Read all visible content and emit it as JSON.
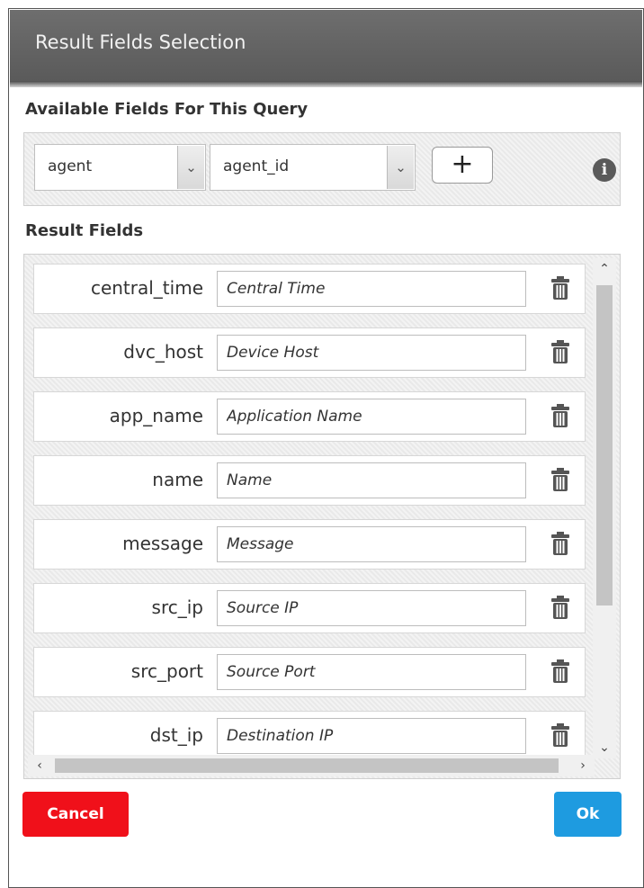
{
  "dialog": {
    "title": "Result Fields Selection"
  },
  "available": {
    "label": "Available Fields For This Query",
    "select1_value": "agent",
    "select2_value": "agent_id",
    "add_label": "+",
    "info_label": "i"
  },
  "results": {
    "label": "Result Fields",
    "rows": [
      {
        "field": "central_time",
        "alias": "Central Time"
      },
      {
        "field": "dvc_host",
        "alias": "Device Host"
      },
      {
        "field": "app_name",
        "alias": "Application Name"
      },
      {
        "field": "name",
        "alias": "Name"
      },
      {
        "field": "message",
        "alias": "Message"
      },
      {
        "field": "src_ip",
        "alias": "Source IP"
      },
      {
        "field": "src_port",
        "alias": "Source Port"
      },
      {
        "field": "dst_ip",
        "alias": "Destination IP"
      }
    ]
  },
  "footer": {
    "cancel_label": "Cancel",
    "ok_label": "Ok"
  },
  "colors": {
    "cancel": "#f0101a",
    "ok": "#1e9be0",
    "titlebar": "#5f5f5f"
  },
  "icons": {
    "dropdown": "chevron-down-icon",
    "add": "plus-icon",
    "info": "info-icon",
    "delete": "trash-icon",
    "scroll": [
      "chevron-up-icon",
      "chevron-down-icon",
      "chevron-left-icon",
      "chevron-right-icon"
    ]
  }
}
